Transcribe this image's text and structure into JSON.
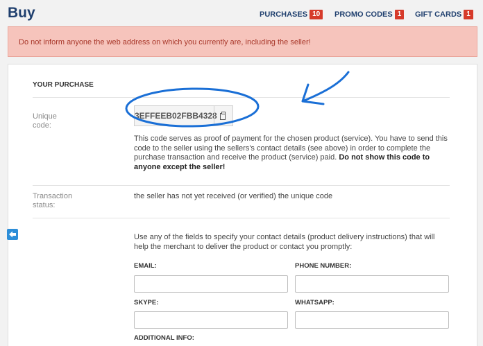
{
  "header": {
    "title": "Buy",
    "nav": [
      {
        "label": "PURCHASES",
        "count": "10"
      },
      {
        "label": "PROMO CODES",
        "count": "1"
      },
      {
        "label": "GIFT CARDS",
        "count": "1"
      }
    ]
  },
  "alert": {
    "text": "Do not inform anyone the web address on which you currently are, including the seller!"
  },
  "purchase": {
    "section_title": "YOUR PURCHASE",
    "code_label": "Unique code:",
    "code_value": "3EFFEEB02FBB4328",
    "code_desc": "This code serves as proof of payment for the chosen product (service). You have to send this code to the seller using the sellers's contact details (see above) in order to complete the purchase transaction and receive the product (service) paid.",
    "code_desc_bold": "Do not show this code to anyone except the seller!",
    "status_label": "Transaction status:",
    "status_value": "the seller has not yet received (or verified) the unique code"
  },
  "contact": {
    "instructions": "Use any of the fields to specify your contact details (product delivery instructions) that will help the merchant to deliver the product or contact you promptly:",
    "fields": {
      "email": "EMAIL:",
      "phone": "PHONE NUMBER:",
      "skype": "SKYPE:",
      "whatsapp": "WHATSAPP:",
      "additional": "ADDITIONAL INFO:"
    }
  },
  "colors": {
    "brand": "#1f3f6e",
    "badge": "#d63a2a",
    "alert_bg": "#f6c4bc",
    "alert_text": "#a8372a",
    "annotation": "#1a6fd6"
  },
  "icons": {
    "copy": "copy-icon",
    "back": "arrow-left-icon"
  }
}
